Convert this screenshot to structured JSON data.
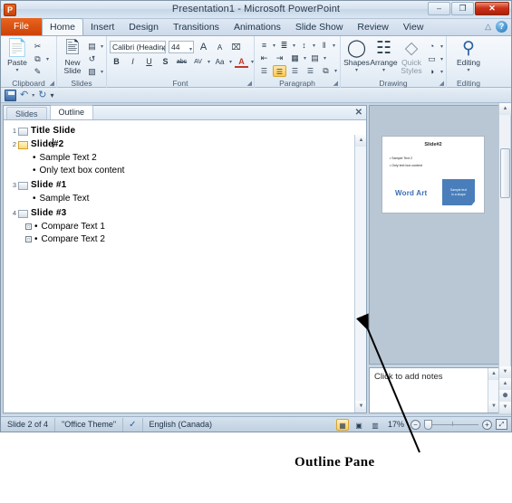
{
  "window": {
    "title": "Presentation1  -  Microsoft PowerPoint",
    "logo": "powerpoint-logo",
    "minimize": "–",
    "maximize": "❐",
    "close": "✕"
  },
  "quick_access": {
    "save": "save-icon",
    "undo": "↶",
    "undo_caret": "▾",
    "redo": "↻",
    "customize": "▾"
  },
  "tabs": {
    "file": "File",
    "items": [
      "Home",
      "Insert",
      "Design",
      "Transitions",
      "Animations",
      "Slide Show",
      "Review",
      "View"
    ],
    "active": "Home",
    "minimize_ribbon": "△",
    "help": "?"
  },
  "ribbon": {
    "clipboard": {
      "label": "Clipboard",
      "paste": "Paste",
      "paste_caret": "▾",
      "cut": "✂",
      "copy": "⧉",
      "copy_caret": "▾",
      "format_painter": "✎",
      "dialog": "◢"
    },
    "slides": {
      "label": "Slides",
      "new_slide": "New\nSlide",
      "new_slide_line1": "New",
      "new_slide_line2": "Slide",
      "new_slide_caret": "▾",
      "layout": "▤",
      "layout_caret": "▾",
      "reset": "↺",
      "section": "▧",
      "section_caret": "▾"
    },
    "font": {
      "label": "Font",
      "font_name": "Calibri (Headings)",
      "font_size": "44",
      "grow": "A",
      "shrink": "A",
      "clear_formatting": "⌧",
      "bold": "B",
      "italic": "I",
      "underline": "U",
      "shadow": "S",
      "strikethrough": "abc",
      "spacing": "AV",
      "spacing_caret": "▾",
      "change_case": "Aa",
      "change_case_caret": "▾",
      "font_color": "A",
      "font_color_caret": "▾",
      "dialog": "◢"
    },
    "paragraph": {
      "label": "Paragraph",
      "bullets": "≡",
      "bullets_caret": "▾",
      "numbering": "≣",
      "numbering_caret": "▾",
      "line_spacing": "↕",
      "line_spacing_caret": "▾",
      "text_direction": "‖",
      "text_direction_caret": "▾",
      "decrease_indent": "⇤",
      "increase_indent": "⇥",
      "columns": "▦",
      "columns_caret": "▾",
      "align_text": "▤",
      "align_text_caret": "▾",
      "align_left": "☰",
      "align_center": "☰",
      "align_right": "☰",
      "justify": "☰",
      "convert_smartart": "⧉",
      "convert_smartart_caret": "▾",
      "dialog": "◢",
      "active_alignment": "align_center"
    },
    "drawing": {
      "label": "Drawing",
      "shapes": "Shapes",
      "shapes_caret": "▾",
      "arrange": "Arrange",
      "arrange_caret": "▾",
      "quick_styles_line1": "Quick",
      "quick_styles_line2": "Styles",
      "quick_styles_caret": "▾",
      "shape_fill": "◔",
      "shape_fill_caret": "▾",
      "shape_outline": "▭",
      "shape_outline_caret": "▾",
      "shape_effects": "◑",
      "shape_effects_caret": "▾",
      "dialog": "◢"
    },
    "editing": {
      "label": "Editing",
      "editing": "Editing",
      "editing_icon": "binoculars-icon",
      "editing_caret": "▾"
    }
  },
  "outline_pane": {
    "tabs": {
      "slides": "Slides",
      "outline": "Outline",
      "active": "Outline"
    },
    "close": "✕",
    "items": [
      {
        "number": "1",
        "title": "Title  Slide",
        "selected": false,
        "bullets": []
      },
      {
        "number": "2",
        "title_before_caret": "Slide",
        "title_after_caret": "#2",
        "title": "Slide#2",
        "selected": true,
        "bullets": [
          {
            "text": "Sample Text 2",
            "collapse": false
          },
          {
            "text": "Only  text box content",
            "collapse": false
          }
        ]
      },
      {
        "number": "3",
        "title": "Slide  #1",
        "selected": false,
        "bullets": [
          {
            "text": "Sample Text",
            "collapse": false
          }
        ]
      },
      {
        "number": "4",
        "title": "Slide  #3",
        "selected": false,
        "bullets": [
          {
            "text": "Compare Text 1",
            "collapse": true,
            "collapse_glyph": "□"
          },
          {
            "text": "Compare Text 2",
            "collapse": true,
            "collapse_glyph": "□"
          }
        ]
      }
    ],
    "scroll_up": "▲",
    "scroll_down": "▼"
  },
  "slide_preview": {
    "title": "Slide#2",
    "bullets": [
      "Sample Text 2",
      "Only text box content"
    ],
    "wordart": "Word Art",
    "shape_text_line1": "Sample text",
    "shape_text_line2": "in a shape",
    "shape_color": "#4a7ebb",
    "wordart_color": "#3c6db5"
  },
  "notes": {
    "placeholder": "Click to add notes"
  },
  "scrollbars": {
    "up": "▲",
    "down": "▼",
    "prev_slide": "▲",
    "next_slide": "▼",
    "all_slides": "⬤"
  },
  "status_bar": {
    "slide_count": "Slide 2 of 4",
    "theme": "\"Office Theme\"",
    "spellcheck_icon": "spellcheck-icon",
    "language": "English (Canada)",
    "views": [
      {
        "name": "normal-view",
        "glyph": "▦",
        "active": true
      },
      {
        "name": "slide-sorter-view",
        "glyph": "▣",
        "active": false
      },
      {
        "name": "reading-view",
        "glyph": "▥",
        "active": false
      }
    ],
    "zoom_out": "−",
    "zoom_in": "+",
    "zoom_level": "17%",
    "fit_to_window": "⤢"
  },
  "annotation": {
    "label": "Outline Pane",
    "arrow_color": "#000000"
  }
}
